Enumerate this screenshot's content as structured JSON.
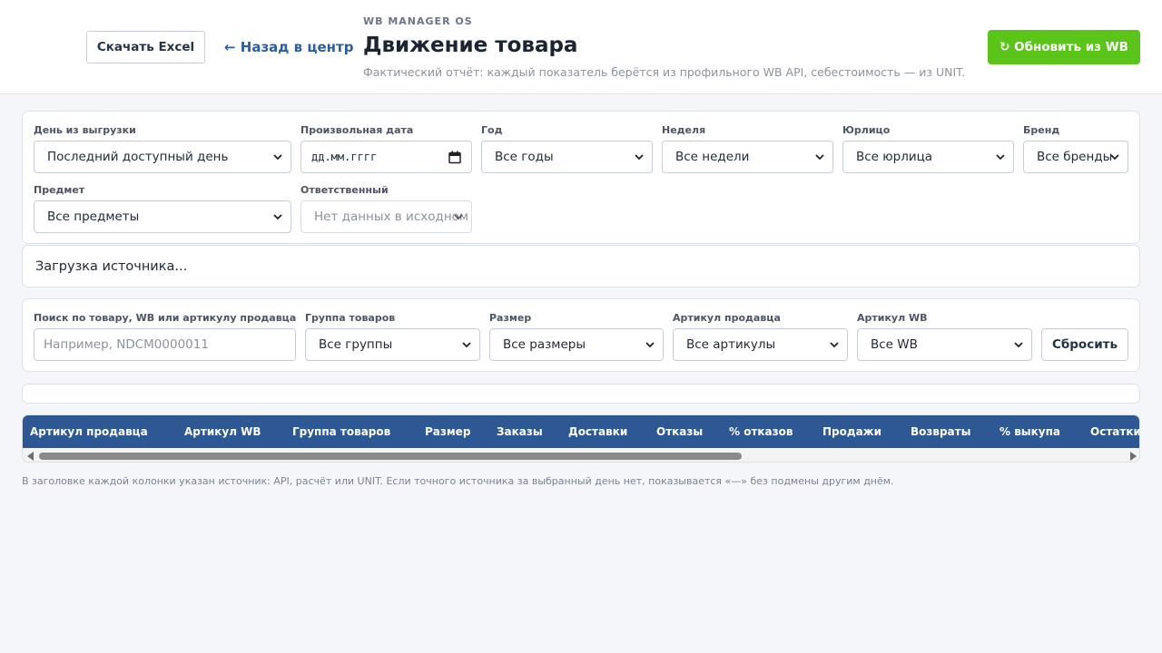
{
  "header": {
    "excel_button": "Скачать Excel",
    "back_link": "← Назад в центр",
    "brand": "WB MANAGER OS",
    "title": "Движение товара",
    "subtitle": "Фактический отчёт: каждый показатель берётся из профильного WB API, себестоимость — из UNIT.",
    "refresh_button": "↻ Обновить из WB"
  },
  "filters": {
    "day": {
      "label": "День из выгрузки",
      "value": "Последний доступный день"
    },
    "custom_date": {
      "label": "Произвольная дата",
      "placeholder": "дд.мм.гггг"
    },
    "year": {
      "label": "Год",
      "value": "Все годы"
    },
    "week": {
      "label": "Неделя",
      "value": "Все недели"
    },
    "legal": {
      "label": "Юрлицо",
      "value": "Все юрлица"
    },
    "brand": {
      "label": "Бренд",
      "value": "Все бренды"
    },
    "subject": {
      "label": "Предмет",
      "value": "Все предметы"
    },
    "responsible": {
      "label": "Ответственный",
      "value": "Нет данных в исходном"
    }
  },
  "status": {
    "text": "Загрузка источника..."
  },
  "search": {
    "query": {
      "label": "Поиск по товару, WB или артикулу продавца",
      "placeholder": "Например, NDCM0000011"
    },
    "group": {
      "label": "Группа товаров",
      "value": "Все группы"
    },
    "size": {
      "label": "Размер",
      "value": "Все размеры"
    },
    "seller_article": {
      "label": "Артикул продавца",
      "value": "Все артикулы"
    },
    "wb_article": {
      "label": "Артикул WB",
      "value": "Все WB"
    },
    "reset_button": "Сбросить"
  },
  "table": {
    "columns": [
      "Артикул продавца",
      "Артикул WB",
      "Группа товаров",
      "Размер",
      "Заказы",
      "Доставки",
      "Отказы",
      "% отказов",
      "Продажи",
      "Возвраты",
      "% выкупа",
      "Остатки"
    ]
  },
  "footnote": "В заголовке каждой колонки указан источник: API, расчёт или UNIT. Если точного источника за выбранный день нет, показывается «—» без подмены другим днём.",
  "colors": {
    "accent_green": "#5ac418",
    "header_blue": "#2e5894",
    "link_blue": "#2c5da4"
  }
}
